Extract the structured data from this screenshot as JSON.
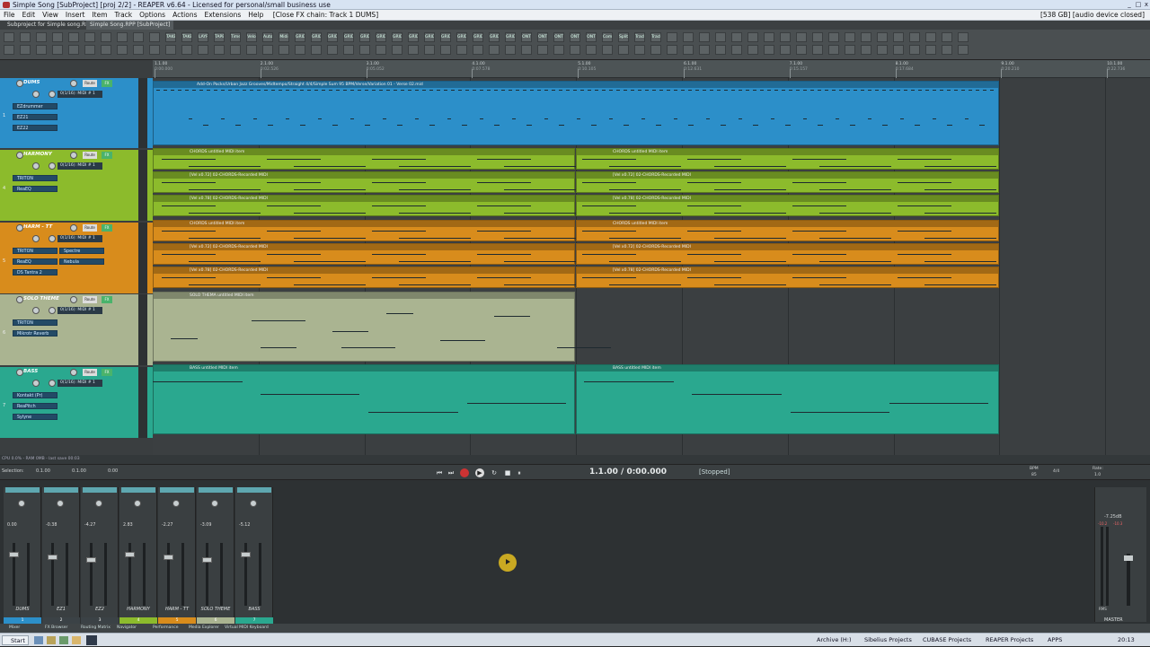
{
  "window": {
    "title": "Simple Song [SubProject] [proj 2/2] - REAPER v6.64 - Licensed for personal/small business use",
    "min": "_",
    "max": "□",
    "close": "x"
  },
  "menu": {
    "items": [
      "File",
      "Edit",
      "View",
      "Insert",
      "Item",
      "Track",
      "Options",
      "Actions",
      "Extensions",
      "Help"
    ],
    "fx_chain": "[Close FX chain: Track 1 DUMS]",
    "memory": "[538 GB] [audio device closed]"
  },
  "project_tabs": [
    "Subproject for Simple song.RPP",
    "Simple Song.RPP [SubProject]"
  ],
  "toolbar_labels": [
    "TAKE REC",
    "TAKE REC",
    "LAYR REC",
    "TAPE REC",
    "Time",
    "Velo",
    "Auto",
    "Midi",
    "GRID 1 BAR",
    "GRID 2",
    "GRID 4",
    "GRID 8",
    "GRID 16",
    "GRID 32",
    "GRID 64",
    "GRID 3T",
    "GRID 6T",
    "GRID 12T",
    "GRID 24T",
    "GRID 48T",
    "GRID 96T",
    "GRID 192T",
    "ONT 4",
    "ONT 8",
    "ONT 16",
    "ONT 32",
    "ONT 64",
    "Comp",
    "Split Item",
    "Track RaCe",
    "Track RaCe"
  ],
  "ruler": {
    "marks": [
      "1.1.00",
      "2.1.00",
      "3.1.00",
      "4.1.00",
      "5.1.00",
      "6.1.00",
      "7.1.00",
      "8.1.00",
      "9.1.00",
      "10.1.00"
    ],
    "times": [
      "0:00.000",
      "0:02.526",
      "0:05.052",
      "0:07.578",
      "0:10.105",
      "0:12.631",
      "0:15.157",
      "0:17.684",
      "0:20.210",
      "0:22.736"
    ]
  },
  "tracks": [
    {
      "num": "1",
      "name": "DUMS",
      "color": "#2c8fc9",
      "midi": "0(1/16): MIDI # 1",
      "fx": [
        "EZdrummer",
        "EZ21",
        "EZ22"
      ]
    },
    {
      "num": "4",
      "name": "HARMONY",
      "color": "#8cbb2c",
      "midi": "0(1/16): MIDI # 1",
      "fx": [
        "TRITON",
        "ReaEQ"
      ]
    },
    {
      "num": "5",
      "name": "HARM - TT",
      "color": "#d88c1c",
      "midi": "0(1/16): MIDI # 1",
      "fx": [
        "TRITON",
        "Spectre",
        "ReaEQ",
        "Nebula",
        "DS Tantra 2"
      ]
    },
    {
      "num": "6",
      "name": "SOLO THEME",
      "color": "#aab491",
      "midi": "0(1/16): MIDI # 1",
      "fx": [
        "TRITON",
        "Mikrotr Reverb"
      ]
    },
    {
      "num": "7",
      "name": "BASS",
      "color": "#2aa88f",
      "midi": "0(1/16): MIDI # 1",
      "fx": [
        "Kontakt (Pr)",
        "ReaPitch",
        "Sylyne"
      ]
    }
  ],
  "track_buttons": {
    "route": "Route",
    "fx": "FX"
  },
  "items": {
    "dums_path": "Add-On Packs/Urban Jazz Grooves/Midtempo/Straight 4/4/Simple Sum 95 BPM/Verse/Variation 01 - Verse 02.mid",
    "chords": "CHORDS untitled MIDI item",
    "chords_rec1": "[Vel x0.72] 02-CHORDS-Recorded MIDI",
    "chords_rec2": "[Vel x0.78] 02-CHORDS-Recorded MIDI",
    "solo": "SOLO THEMA untitled MIDI item",
    "bass": "BASS untitled MIDI item"
  },
  "status": {
    "cpu": "CPU 0.0% - RAM 0MB - last save 00:03",
    "selection_label": "Selection:",
    "sel_start": "0.1.00",
    "sel_end": "0.1.00",
    "sel_len": "0:00",
    "position": "1.1.00 / 0:00.000",
    "state": "[Stopped]",
    "bpm_label": "BPM",
    "bpm": "85",
    "sig": "4/4",
    "rate_label": "Rate:",
    "rate": "1.0"
  },
  "mixer": [
    {
      "name": "DUMS",
      "vol": "0.00",
      "idx": "1",
      "color": "#2c8fc9"
    },
    {
      "name": "EZ1",
      "vol": "-0.38",
      "idx": "2",
      "color": "#3b4246"
    },
    {
      "name": "EZ2",
      "vol": "-4.27",
      "idx": "3",
      "color": "#3b4246"
    },
    {
      "name": "HARMONY",
      "vol": "2.83",
      "idx": "4",
      "color": "#8cbb2c"
    },
    {
      "name": "HARM - TT",
      "vol": "-2.27",
      "idx": "5",
      "color": "#d88c1c"
    },
    {
      "name": "SOLO THEME",
      "vol": "-3.09",
      "idx": "6",
      "color": "#aab491"
    },
    {
      "name": "BASS",
      "vol": "-5.12",
      "idx": "7",
      "color": "#2aa88f"
    }
  ],
  "master": {
    "name": "MASTER",
    "vol": "-7.25dB",
    "peak1": "-10.2",
    "peak2": "-10.3",
    "rms": "RMS"
  },
  "bottom_tabs": [
    "Mixer",
    "FX Browser",
    "Routing Matrix",
    "Navigator",
    "Performance",
    "Media Explorer",
    "Virtual MIDI Keyboard"
  ],
  "taskbar": {
    "start": "Start",
    "items": [
      "Archive (H:)",
      "Sibelius Projects",
      "CUBASE Projects",
      "REAPER Projects",
      "APPS"
    ],
    "clock": "20:13"
  },
  "colors": {
    "accent": "#2c8fc9"
  }
}
